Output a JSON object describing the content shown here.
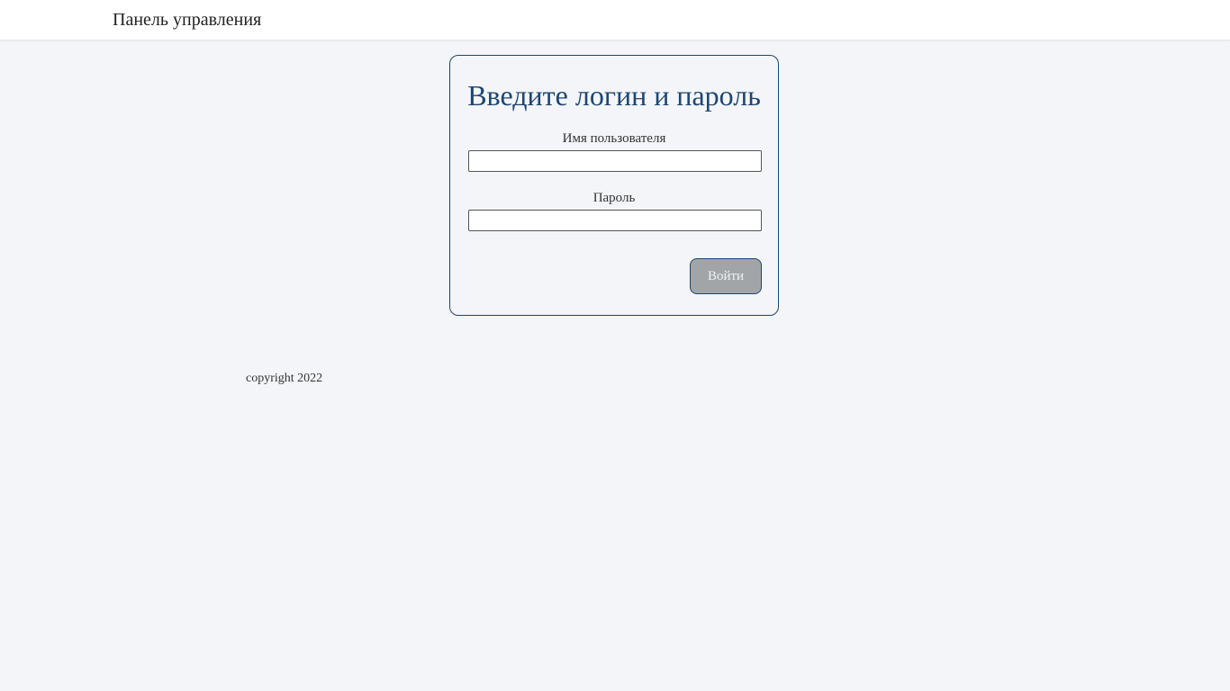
{
  "header": {
    "brand": "Панель управления"
  },
  "login": {
    "title": "Введите логин и пароль",
    "username_label": "Имя пользователя",
    "username_value": "",
    "password_label": "Пароль",
    "password_value": "",
    "submit_label": "Войти"
  },
  "footer": {
    "copyright": "copyright 2022"
  },
  "colors": {
    "accent": "#1f4670",
    "button_bg": "#a2a5a8",
    "page_bg": "#f3f5f8"
  }
}
